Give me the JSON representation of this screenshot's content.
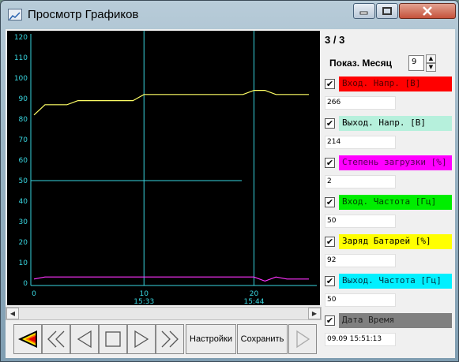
{
  "window": {
    "title": "Просмотр Графиков"
  },
  "chart_data": {
    "type": "line",
    "ylim": [
      0,
      120
    ],
    "xlim": [
      0,
      26
    ],
    "y_ticks": [
      0,
      10,
      20,
      30,
      40,
      50,
      60,
      70,
      80,
      90,
      100,
      110,
      120
    ],
    "x_ticks": [
      {
        "x": 0,
        "label": "0",
        "time": ""
      },
      {
        "x": 10,
        "label": "10",
        "time": "15:33"
      },
      {
        "x": 20,
        "label": "20",
        "time": "15:44"
      }
    ],
    "gridlines_x": [
      10,
      20
    ],
    "gridlines_y": [
      50
    ],
    "series": [
      {
        "color": "#ffff66",
        "x": [
          0,
          1,
          2,
          3,
          4,
          5,
          6,
          7,
          8,
          9,
          10,
          11,
          12,
          13,
          14,
          15,
          16,
          17,
          18,
          19,
          20,
          21,
          22,
          23,
          24,
          25
        ],
        "y": [
          82,
          87,
          87,
          87,
          89,
          89,
          89,
          89,
          89,
          89,
          92,
          92,
          92,
          92,
          92,
          92,
          92,
          92,
          92,
          92,
          94,
          94,
          92,
          92,
          92,
          92
        ]
      },
      {
        "color": "#ff33ff",
        "x": [
          0,
          1,
          2,
          3,
          4,
          5,
          6,
          7,
          8,
          9,
          10,
          11,
          12,
          13,
          14,
          15,
          16,
          17,
          18,
          19,
          20,
          21,
          22,
          23,
          24,
          25
        ],
        "y": [
          2,
          3,
          3,
          3,
          3,
          3,
          3,
          3,
          3,
          3,
          3,
          3,
          3,
          3,
          3,
          3,
          3,
          3,
          3,
          3,
          3,
          1,
          3,
          2,
          2,
          2
        ]
      }
    ]
  },
  "panel": {
    "page_indicator": "3 / 3",
    "month_label": "Показ. Месяц",
    "month_value": "9",
    "params": [
      {
        "label": "Вход. Напр. [В]",
        "value": "266",
        "color": "#ff0000",
        "text_color": "#550000",
        "checked": "✔"
      },
      {
        "label": "Выход. Напр. [В]",
        "value": "214",
        "color": "#b6f0dc",
        "text_color": "#000000",
        "checked": "✔"
      },
      {
        "label": "Степень загрузки [%]",
        "value": "2",
        "color": "#ff00ff",
        "text_color": "#550055",
        "checked": "✔"
      },
      {
        "label": "Вход. Частота [Гц]",
        "value": "50",
        "color": "#00ee00",
        "text_color": "#004400",
        "checked": "✔"
      },
      {
        "label": "Заряд Батарей [%]",
        "value": "92",
        "color": "#ffff00",
        "text_color": "#000000",
        "checked": "✔"
      },
      {
        "label": "Выход. Частота [Гц]",
        "value": "50",
        "color": "#00f0ff",
        "text_color": "#003344",
        "checked": "✔"
      },
      {
        "label": "Дата Время",
        "value": "09.09 15:51:13",
        "color": "#808080",
        "text_color": "#222222",
        "checked": "✔"
      }
    ]
  },
  "toolbar": {
    "settings_label": "Настройки",
    "save_label": "Сохранить"
  }
}
